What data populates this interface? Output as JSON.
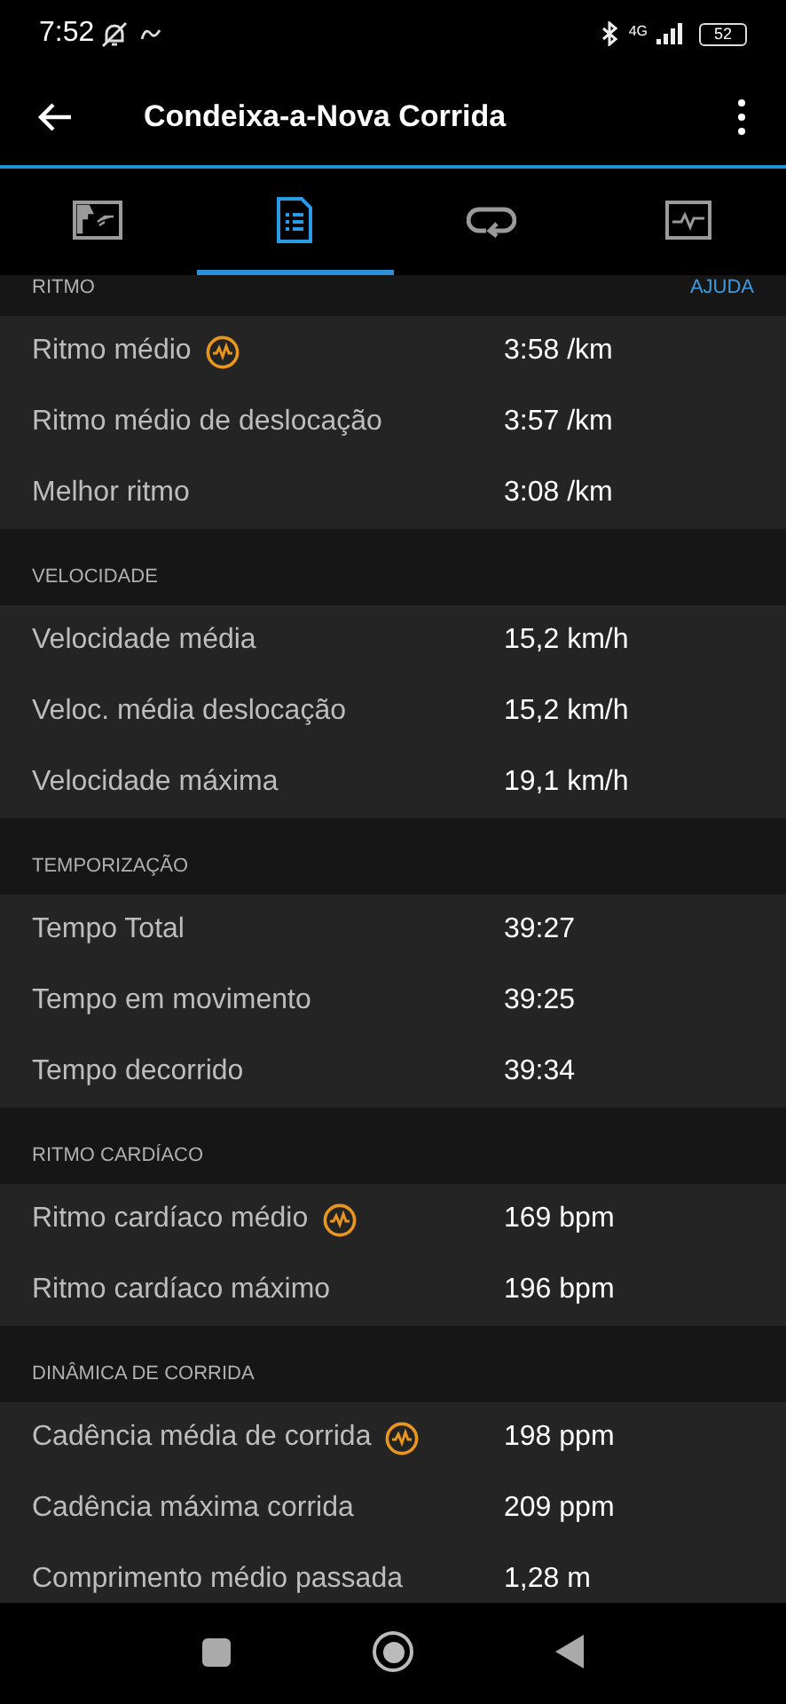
{
  "status_bar": {
    "time": "7:52",
    "network": "4G",
    "battery": "52"
  },
  "app_bar": {
    "title": "Condeixa-a-Nova Corrida"
  },
  "tabs": [
    {
      "kind": "map",
      "selected": false
    },
    {
      "kind": "list",
      "selected": true
    },
    {
      "kind": "laps",
      "selected": false
    },
    {
      "kind": "chart",
      "selected": false
    }
  ],
  "sections": [
    {
      "title": "RITMO",
      "action": "AJUDA",
      "rows": [
        {
          "label": "Ritmo médio",
          "value": "3:58 /km",
          "badge": true
        },
        {
          "label": "Ritmo médio de deslocação",
          "value": "3:57 /km",
          "badge": false
        },
        {
          "label": "Melhor ritmo",
          "value": "3:08 /km",
          "badge": false
        }
      ]
    },
    {
      "title": "VELOCIDADE",
      "rows": [
        {
          "label": "Velocidade média",
          "value": "15,2 km/h",
          "badge": false
        },
        {
          "label": "Veloc. média deslocação",
          "value": "15,2 km/h",
          "badge": false
        },
        {
          "label": "Velocidade máxima",
          "value": "19,1 km/h",
          "badge": false
        }
      ]
    },
    {
      "title": "TEMPORIZAÇÃO",
      "rows": [
        {
          "label": "Tempo Total",
          "value": "39:27",
          "badge": false
        },
        {
          "label": "Tempo em movimento",
          "value": "39:25",
          "badge": false
        },
        {
          "label": "Tempo decorrido",
          "value": "39:34",
          "badge": false
        }
      ]
    },
    {
      "title": "RITMO CARDÍACO",
      "rows": [
        {
          "label": "Ritmo cardíaco médio",
          "value": "169 bpm",
          "badge": true
        },
        {
          "label": "Ritmo cardíaco máximo",
          "value": "196 bpm",
          "badge": false
        }
      ]
    },
    {
      "title": "DINÂMICA DE CORRIDA",
      "rows": [
        {
          "label": "Cadência média de corrida",
          "value": "198 ppm",
          "badge": true
        },
        {
          "label": "Cadência máxima corrida",
          "value": "209 ppm",
          "badge": false
        },
        {
          "label": "Comprimento médio passada",
          "value": "1,28 m",
          "badge": false
        }
      ]
    }
  ]
}
